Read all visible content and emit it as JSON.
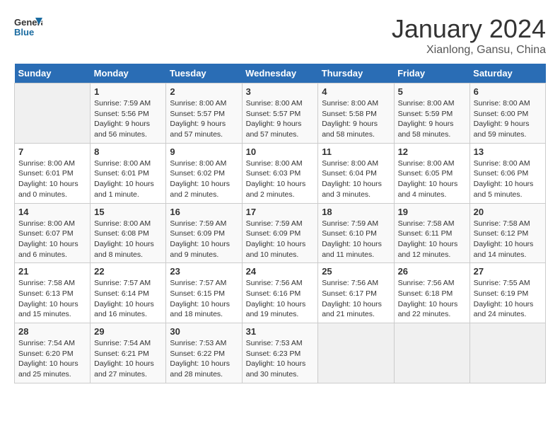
{
  "header": {
    "logo_line1": "General",
    "logo_line2": "Blue",
    "month": "January 2024",
    "location": "Xianlong, Gansu, China"
  },
  "days_of_week": [
    "Sunday",
    "Monday",
    "Tuesday",
    "Wednesday",
    "Thursday",
    "Friday",
    "Saturday"
  ],
  "weeks": [
    [
      {
        "day": "",
        "info": ""
      },
      {
        "day": "1",
        "info": "Sunrise: 7:59 AM\nSunset: 5:56 PM\nDaylight: 9 hours\nand 56 minutes."
      },
      {
        "day": "2",
        "info": "Sunrise: 8:00 AM\nSunset: 5:57 PM\nDaylight: 9 hours\nand 57 minutes."
      },
      {
        "day": "3",
        "info": "Sunrise: 8:00 AM\nSunset: 5:57 PM\nDaylight: 9 hours\nand 57 minutes."
      },
      {
        "day": "4",
        "info": "Sunrise: 8:00 AM\nSunset: 5:58 PM\nDaylight: 9 hours\nand 58 minutes."
      },
      {
        "day": "5",
        "info": "Sunrise: 8:00 AM\nSunset: 5:59 PM\nDaylight: 9 hours\nand 58 minutes."
      },
      {
        "day": "6",
        "info": "Sunrise: 8:00 AM\nSunset: 6:00 PM\nDaylight: 9 hours\nand 59 minutes."
      }
    ],
    [
      {
        "day": "7",
        "info": "Sunrise: 8:00 AM\nSunset: 6:01 PM\nDaylight: 10 hours\nand 0 minutes."
      },
      {
        "day": "8",
        "info": "Sunrise: 8:00 AM\nSunset: 6:01 PM\nDaylight: 10 hours\nand 1 minute."
      },
      {
        "day": "9",
        "info": "Sunrise: 8:00 AM\nSunset: 6:02 PM\nDaylight: 10 hours\nand 2 minutes."
      },
      {
        "day": "10",
        "info": "Sunrise: 8:00 AM\nSunset: 6:03 PM\nDaylight: 10 hours\nand 2 minutes."
      },
      {
        "day": "11",
        "info": "Sunrise: 8:00 AM\nSunset: 6:04 PM\nDaylight: 10 hours\nand 3 minutes."
      },
      {
        "day": "12",
        "info": "Sunrise: 8:00 AM\nSunset: 6:05 PM\nDaylight: 10 hours\nand 4 minutes."
      },
      {
        "day": "13",
        "info": "Sunrise: 8:00 AM\nSunset: 6:06 PM\nDaylight: 10 hours\nand 5 minutes."
      }
    ],
    [
      {
        "day": "14",
        "info": "Sunrise: 8:00 AM\nSunset: 6:07 PM\nDaylight: 10 hours\nand 6 minutes."
      },
      {
        "day": "15",
        "info": "Sunrise: 8:00 AM\nSunset: 6:08 PM\nDaylight: 10 hours\nand 8 minutes."
      },
      {
        "day": "16",
        "info": "Sunrise: 7:59 AM\nSunset: 6:09 PM\nDaylight: 10 hours\nand 9 minutes."
      },
      {
        "day": "17",
        "info": "Sunrise: 7:59 AM\nSunset: 6:09 PM\nDaylight: 10 hours\nand 10 minutes."
      },
      {
        "day": "18",
        "info": "Sunrise: 7:59 AM\nSunset: 6:10 PM\nDaylight: 10 hours\nand 11 minutes."
      },
      {
        "day": "19",
        "info": "Sunrise: 7:58 AM\nSunset: 6:11 PM\nDaylight: 10 hours\nand 12 minutes."
      },
      {
        "day": "20",
        "info": "Sunrise: 7:58 AM\nSunset: 6:12 PM\nDaylight: 10 hours\nand 14 minutes."
      }
    ],
    [
      {
        "day": "21",
        "info": "Sunrise: 7:58 AM\nSunset: 6:13 PM\nDaylight: 10 hours\nand 15 minutes."
      },
      {
        "day": "22",
        "info": "Sunrise: 7:57 AM\nSunset: 6:14 PM\nDaylight: 10 hours\nand 16 minutes."
      },
      {
        "day": "23",
        "info": "Sunrise: 7:57 AM\nSunset: 6:15 PM\nDaylight: 10 hours\nand 18 minutes."
      },
      {
        "day": "24",
        "info": "Sunrise: 7:56 AM\nSunset: 6:16 PM\nDaylight: 10 hours\nand 19 minutes."
      },
      {
        "day": "25",
        "info": "Sunrise: 7:56 AM\nSunset: 6:17 PM\nDaylight: 10 hours\nand 21 minutes."
      },
      {
        "day": "26",
        "info": "Sunrise: 7:56 AM\nSunset: 6:18 PM\nDaylight: 10 hours\nand 22 minutes."
      },
      {
        "day": "27",
        "info": "Sunrise: 7:55 AM\nSunset: 6:19 PM\nDaylight: 10 hours\nand 24 minutes."
      }
    ],
    [
      {
        "day": "28",
        "info": "Sunrise: 7:54 AM\nSunset: 6:20 PM\nDaylight: 10 hours\nand 25 minutes."
      },
      {
        "day": "29",
        "info": "Sunrise: 7:54 AM\nSunset: 6:21 PM\nDaylight: 10 hours\nand 27 minutes."
      },
      {
        "day": "30",
        "info": "Sunrise: 7:53 AM\nSunset: 6:22 PM\nDaylight: 10 hours\nand 28 minutes."
      },
      {
        "day": "31",
        "info": "Sunrise: 7:53 AM\nSunset: 6:23 PM\nDaylight: 10 hours\nand 30 minutes."
      },
      {
        "day": "",
        "info": ""
      },
      {
        "day": "",
        "info": ""
      },
      {
        "day": "",
        "info": ""
      }
    ]
  ]
}
